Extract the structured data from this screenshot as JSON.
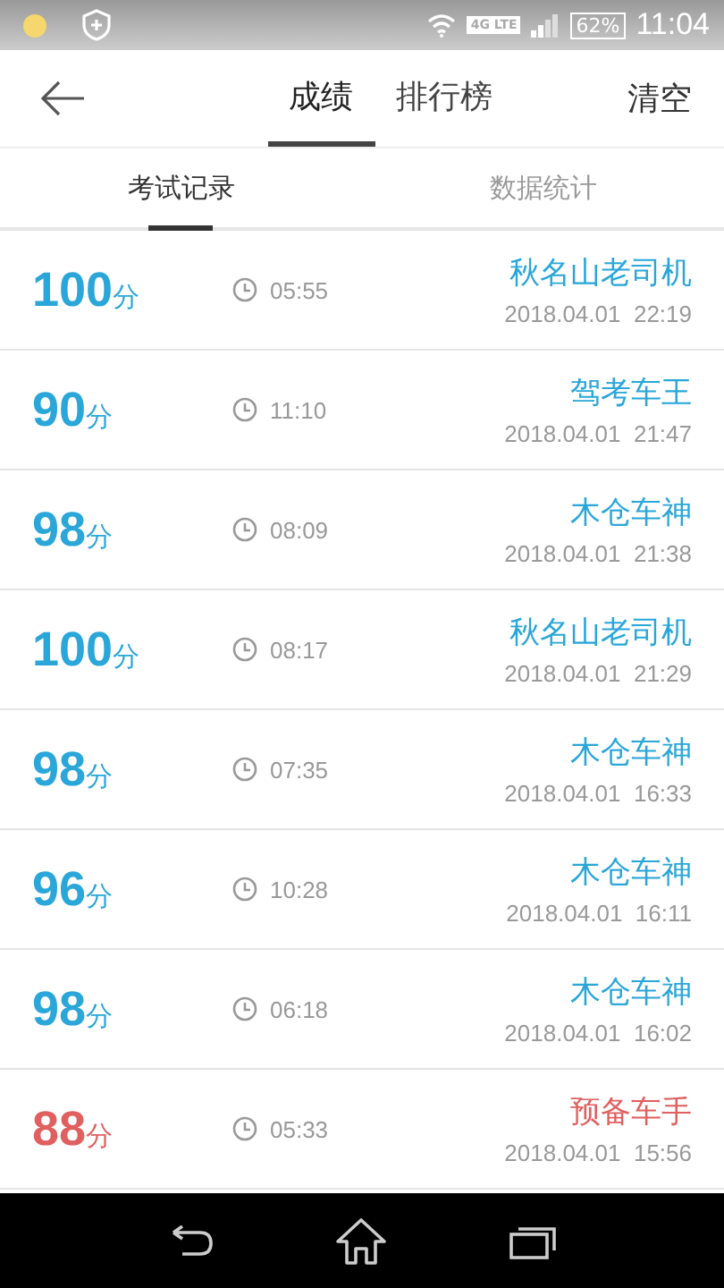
{
  "status_bar": {
    "network": "4G LTE",
    "battery": "62%",
    "time": "11:04"
  },
  "header": {
    "tabs": [
      {
        "label": "成绩",
        "selected": true
      },
      {
        "label": "排行榜",
        "selected": false
      }
    ],
    "action": "清空"
  },
  "subtabs": [
    {
      "label": "考试记录",
      "selected": true
    },
    {
      "label": "数据统计",
      "selected": false
    }
  ],
  "records": [
    {
      "score": "100",
      "unit": "分",
      "duration": "05:55",
      "title": "秋名山老司机",
      "date": "2018.04.01  22:19",
      "color": "#2aa6d8"
    },
    {
      "score": "90",
      "unit": "分",
      "duration": "11:10",
      "title": "驾考车王",
      "date": "2018.04.01  21:47",
      "color": "#2aa6d8"
    },
    {
      "score": "98",
      "unit": "分",
      "duration": "08:09",
      "title": "木仓车神",
      "date": "2018.04.01  21:38",
      "color": "#2aa6d8"
    },
    {
      "score": "100",
      "unit": "分",
      "duration": "08:17",
      "title": "秋名山老司机",
      "date": "2018.04.01  21:29",
      "color": "#2aa6d8"
    },
    {
      "score": "98",
      "unit": "分",
      "duration": "07:35",
      "title": "木仓车神",
      "date": "2018.04.01  16:33",
      "color": "#2aa6d8"
    },
    {
      "score": "96",
      "unit": "分",
      "duration": "10:28",
      "title": "木仓车神",
      "date": "2018.04.01  16:11",
      "color": "#2aa6d8"
    },
    {
      "score": "98",
      "unit": "分",
      "duration": "06:18",
      "title": "木仓车神",
      "date": "2018.04.01  16:02",
      "color": "#2aa6d8"
    },
    {
      "score": "88",
      "unit": "分",
      "duration": "05:33",
      "title": "预备车手",
      "date": "2018.04.01  15:56",
      "color": "#e06060"
    }
  ]
}
